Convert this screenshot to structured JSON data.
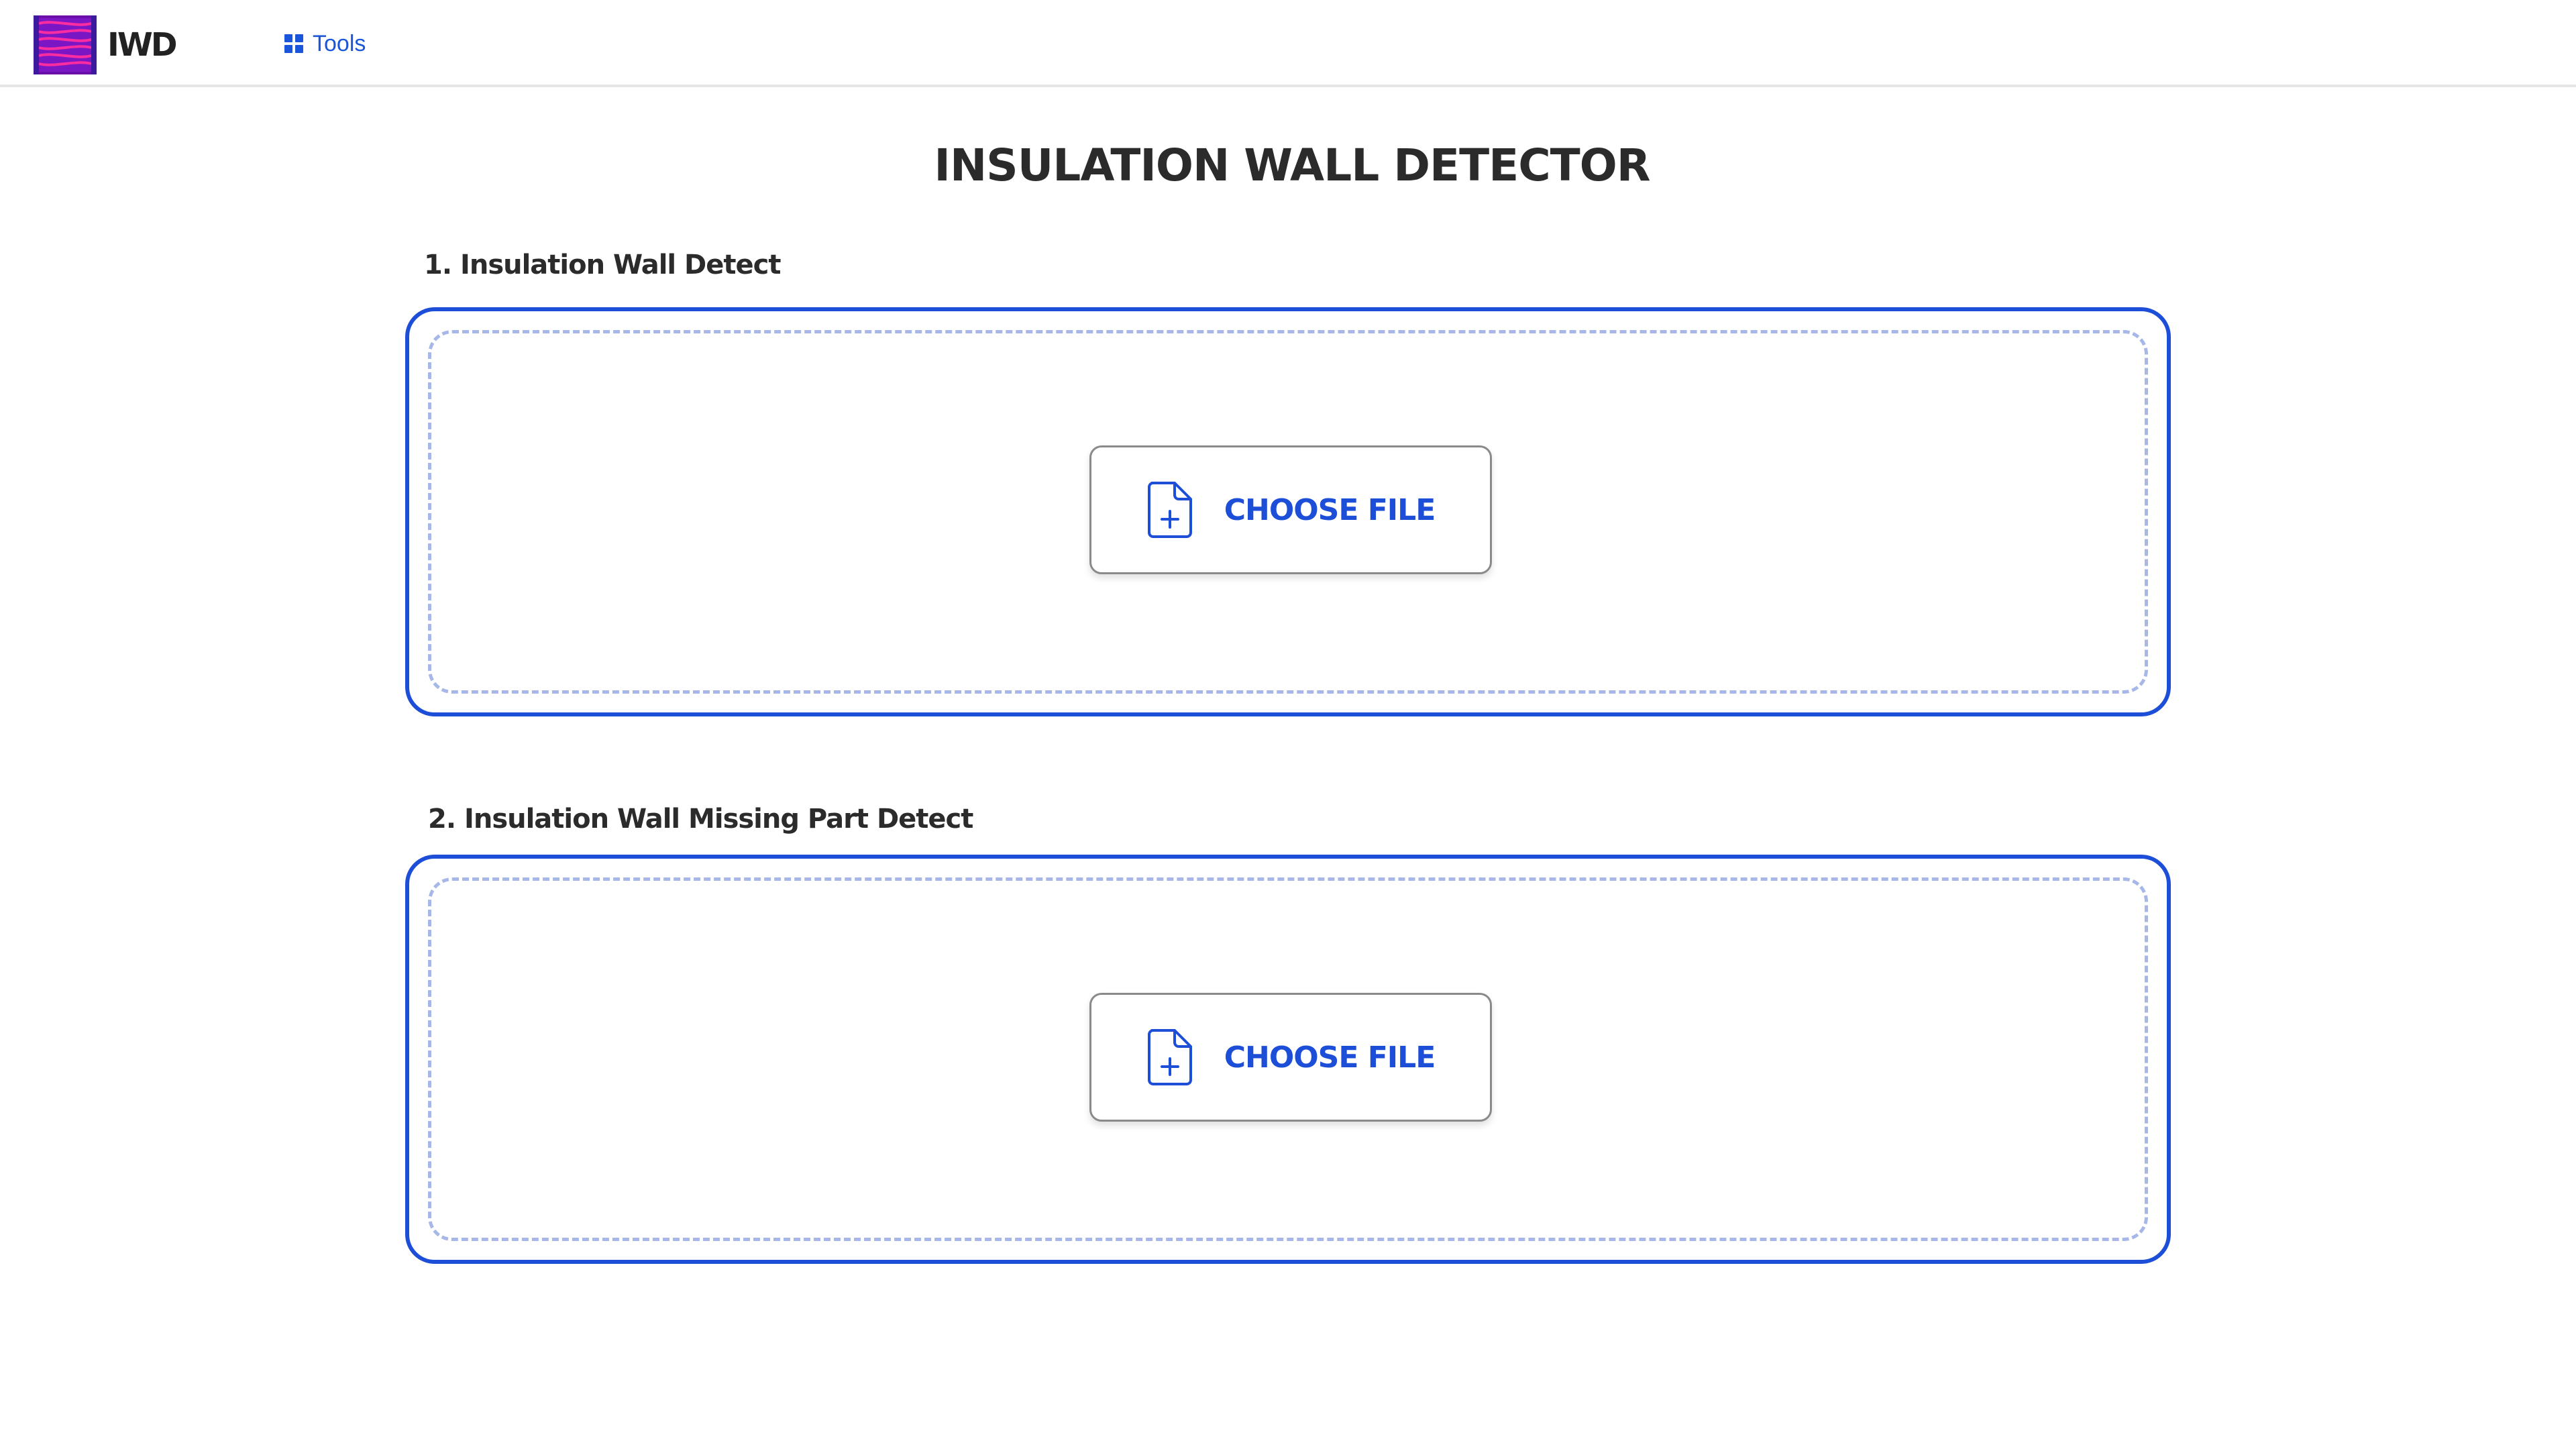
{
  "app": {
    "brand": "IWD",
    "logo_icon": "insulation-wall-logo-icon",
    "accent_color": "#1d4ed8"
  },
  "nav": {
    "tools_icon": "grid-icon",
    "tools_label": "Tools"
  },
  "page": {
    "title": "INSULATION WALL DETECTOR"
  },
  "sections": [
    {
      "label": "1. Insulation Wall Detect",
      "button_label": "CHOOSE FILE",
      "button_icon": "file-plus-icon"
    },
    {
      "label": "2. Insulation Wall Missing Part Detect",
      "button_label": "CHOOSE FILE",
      "button_icon": "file-plus-icon"
    }
  ]
}
